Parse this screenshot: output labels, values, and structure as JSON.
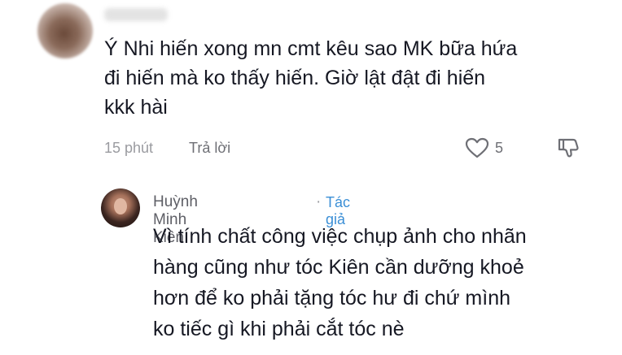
{
  "comment": {
    "author": "",
    "text_lines": [
      "Ý Nhi hiến xong mn cmt kêu sao MK bữa hứa",
      "đi hiến mà ko thấy hiến. Giờ lật đật đi hiến",
      "kkk hài"
    ],
    "time": "15 phút",
    "reply_label": "Trả lời",
    "like_count": "5"
  },
  "reply": {
    "author": "Huỳnh Minh Kiên",
    "separator": "·",
    "badge": "Tác giả",
    "text_lines": [
      "Vì tính chất công việc chụp ảnh cho nhãn",
      "hàng cũng như tóc Kiên cần dưỡng khoẻ",
      "hơn để ko phải tặng tóc hư đi chứ mình",
      "ko tiếc gì khi phải cắt tóc nè"
    ]
  },
  "icons": {
    "like": "heart-outline-icon",
    "dislike": "thumbs-down-icon"
  },
  "colors": {
    "text": "#161823",
    "muted": "#9a9ba0",
    "author_badge": "#3b8fd6"
  }
}
